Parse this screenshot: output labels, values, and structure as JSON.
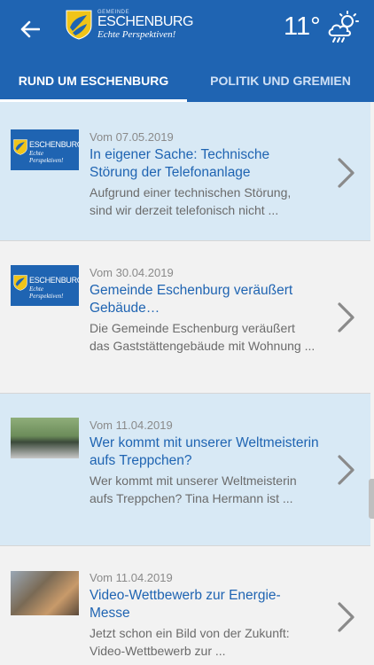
{
  "header": {
    "logo_small": "GEMEINDE",
    "logo_name": "ESCHENBURG",
    "logo_tagline": "Echte Perspektiven!",
    "temperature": "11°",
    "weather_icon": "sun-cloud-rain-icon",
    "back_icon": "arrow-left-icon"
  },
  "tabs": [
    {
      "label": "RUND UM ESCHENBURG",
      "active": true
    },
    {
      "label": "POLITIK UND GREMIEN",
      "active": false
    }
  ],
  "colors": {
    "brand": "#1f64b2",
    "highlight": "#d8e9f5"
  },
  "news": [
    {
      "date": "Vom 07.05.2019",
      "title": "In eigener Sache: Technische Störung der Telefonanlage",
      "description": "Aufgrund einer technischen Störung, sind wir derzeit telefonisch nicht ...",
      "thumb": "logo",
      "thumb_name": "ESCHENBURG",
      "thumb_tag": "Echte Perspektiven!"
    },
    {
      "date": "Vom 30.04.2019",
      "title": "Gemeinde Eschenburg veräußert Gebäude…",
      "description": "Die Gemeinde Eschenburg veräußert das Gaststättengebäude mit Wohnung ...",
      "thumb": "logo",
      "thumb_name": "ESCHENBURG",
      "thumb_tag": "Echte Perspektiven!"
    },
    {
      "date": "Vom 11.04.2019",
      "title": "Wer kommt mit unserer Weltmeisterin aufs Treppchen?",
      "description": "Wer kommt mit unserer Weltmeisterin aufs Treppchen? Tina Hermann ist ...",
      "thumb": "photo"
    },
    {
      "date": "Vom 11.04.2019",
      "title": "Video-Wettbewerb zur Energie-Messe",
      "description": "Jetzt schon ein Bild von der Zukunft: Video-Wettbewerb zur ...",
      "thumb": "photo"
    }
  ]
}
